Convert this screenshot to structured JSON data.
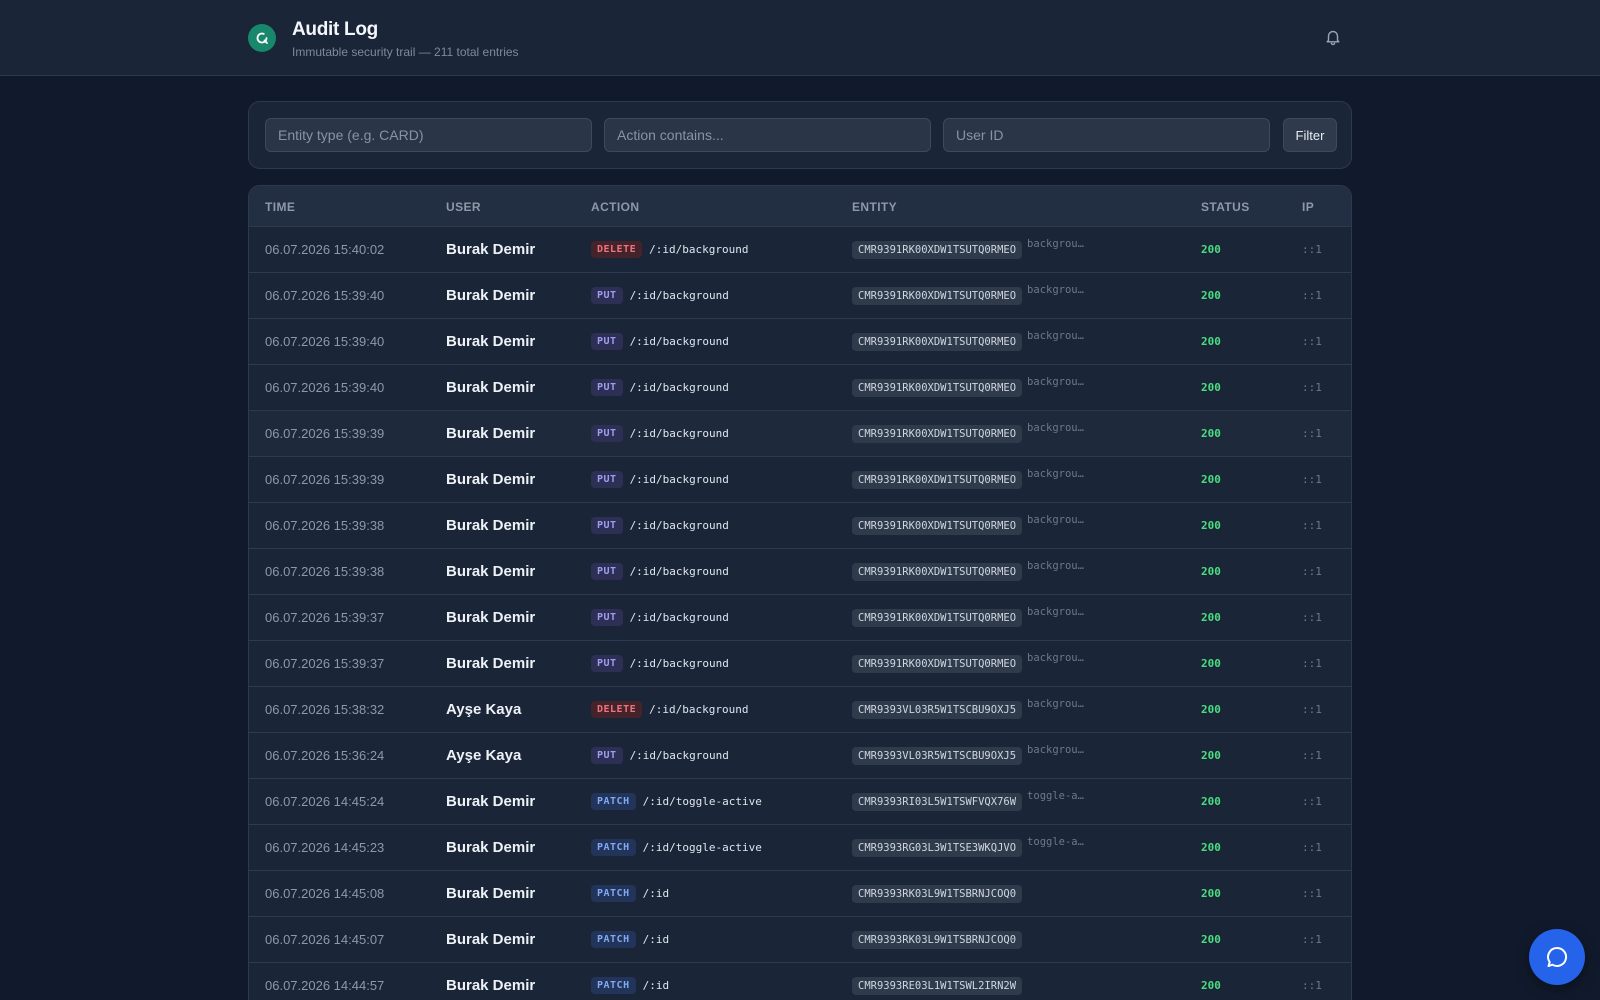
{
  "header": {
    "title": "Audit Log",
    "subtitle": "Immutable security trail — 211 total entries",
    "logo_icon": "search-refresh-icon",
    "bell_icon": "bell-icon"
  },
  "filters": {
    "entity_placeholder": "Entity type (e.g. CARD)",
    "action_placeholder": "Action contains...",
    "user_placeholder": "User ID",
    "filter_label": "Filter"
  },
  "table": {
    "columns": [
      "TIME",
      "USER",
      "ACTION",
      "ENTITY",
      "STATUS",
      "IP"
    ],
    "rows": [
      {
        "time": "06.07.2026 15:40:02",
        "user": "Burak Demir",
        "method": "DELETE",
        "path": "/:id/background",
        "entity_id": "CMR9391RK00XDW1TSUTQ0RMEO",
        "entity_type": "backgrou…",
        "status": "200",
        "ip": "::1"
      },
      {
        "time": "06.07.2026 15:39:40",
        "user": "Burak Demir",
        "method": "PUT",
        "path": "/:id/background",
        "entity_id": "CMR9391RK00XDW1TSUTQ0RMEO",
        "entity_type": "backgrou…",
        "status": "200",
        "ip": "::1"
      },
      {
        "time": "06.07.2026 15:39:40",
        "user": "Burak Demir",
        "method": "PUT",
        "path": "/:id/background",
        "entity_id": "CMR9391RK00XDW1TSUTQ0RMEO",
        "entity_type": "backgrou…",
        "status": "200",
        "ip": "::1"
      },
      {
        "time": "06.07.2026 15:39:40",
        "user": "Burak Demir",
        "method": "PUT",
        "path": "/:id/background",
        "entity_id": "CMR9391RK00XDW1TSUTQ0RMEO",
        "entity_type": "backgrou…",
        "status": "200",
        "ip": "::1"
      },
      {
        "time": "06.07.2026 15:39:39",
        "user": "Burak Demir",
        "method": "PUT",
        "path": "/:id/background",
        "entity_id": "CMR9391RK00XDW1TSUTQ0RMEO",
        "entity_type": "backgrou…",
        "status": "200",
        "ip": "::1"
      },
      {
        "time": "06.07.2026 15:39:39",
        "user": "Burak Demir",
        "method": "PUT",
        "path": "/:id/background",
        "entity_id": "CMR9391RK00XDW1TSUTQ0RMEO",
        "entity_type": "backgrou…",
        "status": "200",
        "ip": "::1"
      },
      {
        "time": "06.07.2026 15:39:38",
        "user": "Burak Demir",
        "method": "PUT",
        "path": "/:id/background",
        "entity_id": "CMR9391RK00XDW1TSUTQ0RMEO",
        "entity_type": "backgrou…",
        "status": "200",
        "ip": "::1"
      },
      {
        "time": "06.07.2026 15:39:38",
        "user": "Burak Demir",
        "method": "PUT",
        "path": "/:id/background",
        "entity_id": "CMR9391RK00XDW1TSUTQ0RMEO",
        "entity_type": "backgrou…",
        "status": "200",
        "ip": "::1"
      },
      {
        "time": "06.07.2026 15:39:37",
        "user": "Burak Demir",
        "method": "PUT",
        "path": "/:id/background",
        "entity_id": "CMR9391RK00XDW1TSUTQ0RMEO",
        "entity_type": "backgrou…",
        "status": "200",
        "ip": "::1"
      },
      {
        "time": "06.07.2026 15:39:37",
        "user": "Burak Demir",
        "method": "PUT",
        "path": "/:id/background",
        "entity_id": "CMR9391RK00XDW1TSUTQ0RMEO",
        "entity_type": "backgrou…",
        "status": "200",
        "ip": "::1"
      },
      {
        "time": "06.07.2026 15:38:32",
        "user": "Ayşe Kaya",
        "method": "DELETE",
        "path": "/:id/background",
        "entity_id": "CMR9393VL03R5W1TSCBU9OXJ5",
        "entity_type": "backgrou…",
        "status": "200",
        "ip": "::1"
      },
      {
        "time": "06.07.2026 15:36:24",
        "user": "Ayşe Kaya",
        "method": "PUT",
        "path": "/:id/background",
        "entity_id": "CMR9393VL03R5W1TSCBU9OXJ5",
        "entity_type": "backgrou…",
        "status": "200",
        "ip": "::1"
      },
      {
        "time": "06.07.2026 14:45:24",
        "user": "Burak Demir",
        "method": "PATCH",
        "path": "/:id/toggle-active",
        "entity_id": "CMR9393RI03L5W1TSWFVQX76W",
        "entity_type": "toggle-a…",
        "status": "200",
        "ip": "::1"
      },
      {
        "time": "06.07.2026 14:45:23",
        "user": "Burak Demir",
        "method": "PATCH",
        "path": "/:id/toggle-active",
        "entity_id": "CMR9393RG03L3W1TSE3WKQJVO",
        "entity_type": "toggle-a…",
        "status": "200",
        "ip": "::1"
      },
      {
        "time": "06.07.2026 14:45:08",
        "user": "Burak Demir",
        "method": "PATCH",
        "path": "/:id",
        "entity_id": "CMR9393RK03L9W1TSBRNJCOQ0",
        "entity_type": "",
        "status": "200",
        "ip": "::1"
      },
      {
        "time": "06.07.2026 14:45:07",
        "user": "Burak Demir",
        "method": "PATCH",
        "path": "/:id",
        "entity_id": "CMR9393RK03L9W1TSBRNJCOQ0",
        "entity_type": "",
        "status": "200",
        "ip": "::1"
      },
      {
        "time": "06.07.2026 14:44:57",
        "user": "Burak Demir",
        "method": "PATCH",
        "path": "/:id",
        "entity_id": "CMR9393RE03L1W1TSWL2IRN2W",
        "entity_type": "",
        "status": "200",
        "ip": "::1"
      }
    ]
  },
  "chat": {
    "icon": "chat-bubble-icon"
  },
  "colors": {
    "background": "#111a2c",
    "card": "#1a2537",
    "logo": "#18876b",
    "status_ok": "#4ade80",
    "chat_button": "#2563eb"
  }
}
